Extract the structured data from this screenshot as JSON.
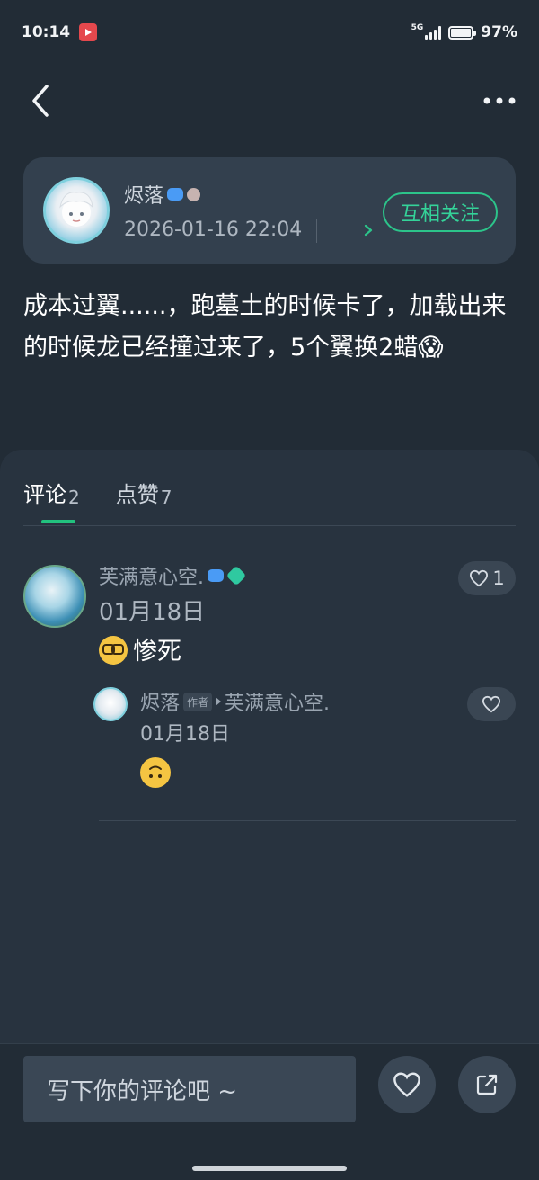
{
  "status_bar": {
    "time": "10:14",
    "network": "5G",
    "battery": "97%",
    "battery_level": 0.97
  },
  "nav": {
    "back_icon": "chevron-left-icon",
    "more_icon": "more-horizontal-icon"
  },
  "post": {
    "author": {
      "name": "烬落",
      "timestamp": "2026-01-16 22:04",
      "follow_label": "互相关注"
    },
    "text": "成本过翼......，跑墓土的时候卡了，加载出来的时候龙已经撞过来了，5个翼换2蜡😱"
  },
  "tabs": {
    "comments_label": "评论",
    "comments_count": "2",
    "likes_label": "点赞",
    "likes_count": "7"
  },
  "comments": [
    {
      "name": "芙满意心空.",
      "date": "01月18日",
      "text": "惨死",
      "emoji": "nerd-face-emoji",
      "like_count": "1"
    }
  ],
  "reply": {
    "name": "烬落",
    "author_tag": "作者",
    "reply_to": "芙满意心空.",
    "date": "01月18日",
    "emoji": "upside-down-face-emoji"
  },
  "bottom": {
    "input_placeholder": "写下你的评论吧 ~",
    "like_icon": "heart-icon",
    "share_icon": "share-icon"
  },
  "colors": {
    "background": "#222c36",
    "card": "#33404e",
    "accent_green": "#2cc48a"
  }
}
